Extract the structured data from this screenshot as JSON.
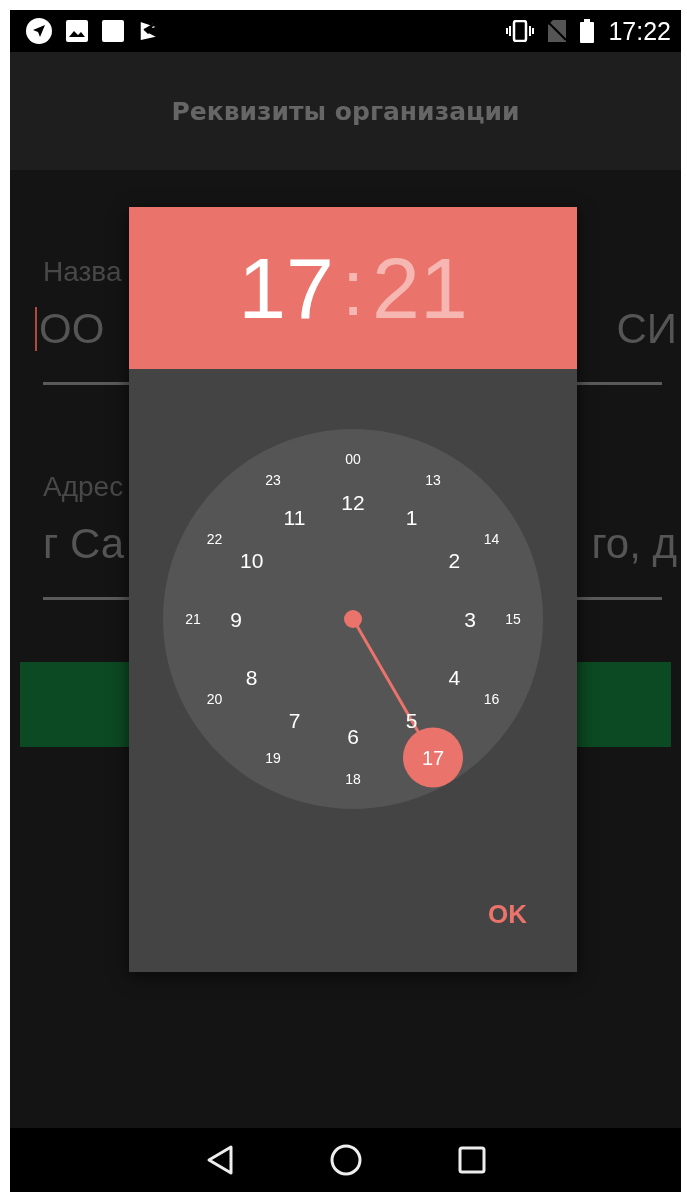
{
  "status_bar": {
    "time": "17:22"
  },
  "app_bar": {
    "title": "Реквизиты организации"
  },
  "fields": [
    {
      "label": "Назва",
      "value_start": "ОО",
      "value_end": "СИ",
      "focused": true
    },
    {
      "label": "Адрес",
      "value_start": "г Са",
      "value_end": "го, д",
      "focused": false
    }
  ],
  "time_picker": {
    "hour": {
      "text": "17",
      "selected": true
    },
    "separator": ":",
    "minute": {
      "text": "21",
      "selected": false
    },
    "dial": [
      {
        "text": "12",
        "kind": "inner",
        "selected": false
      },
      {
        "text": "1",
        "kind": "inner",
        "selected": false
      },
      {
        "text": "2",
        "kind": "inner",
        "selected": false
      },
      {
        "text": "3",
        "kind": "inner",
        "selected": false
      },
      {
        "text": "4",
        "kind": "inner",
        "selected": false
      },
      {
        "text": "5",
        "kind": "inner",
        "selected": false
      },
      {
        "text": "6",
        "kind": "inner",
        "selected": false
      },
      {
        "text": "7",
        "kind": "inner",
        "selected": false
      },
      {
        "text": "8",
        "kind": "inner",
        "selected": false
      },
      {
        "text": "9",
        "kind": "inner",
        "selected": false
      },
      {
        "text": "10",
        "kind": "inner",
        "selected": false
      },
      {
        "text": "11",
        "kind": "inner",
        "selected": false
      },
      {
        "text": "00",
        "kind": "outer",
        "selected": false
      },
      {
        "text": "13",
        "kind": "outer",
        "selected": false
      },
      {
        "text": "14",
        "kind": "outer",
        "selected": false
      },
      {
        "text": "15",
        "kind": "outer",
        "selected": false
      },
      {
        "text": "16",
        "kind": "outer",
        "selected": false
      },
      {
        "text": "17",
        "kind": "outer",
        "selected": true
      },
      {
        "text": "18",
        "kind": "outer",
        "selected": false
      },
      {
        "text": "19",
        "kind": "outer",
        "selected": false
      },
      {
        "text": "20",
        "kind": "outer",
        "selected": false
      },
      {
        "text": "21",
        "kind": "outer",
        "selected": false
      },
      {
        "text": "22",
        "kind": "outer",
        "selected": false
      },
      {
        "text": "23",
        "kind": "outer",
        "selected": false
      }
    ],
    "ok_button": "OK"
  }
}
